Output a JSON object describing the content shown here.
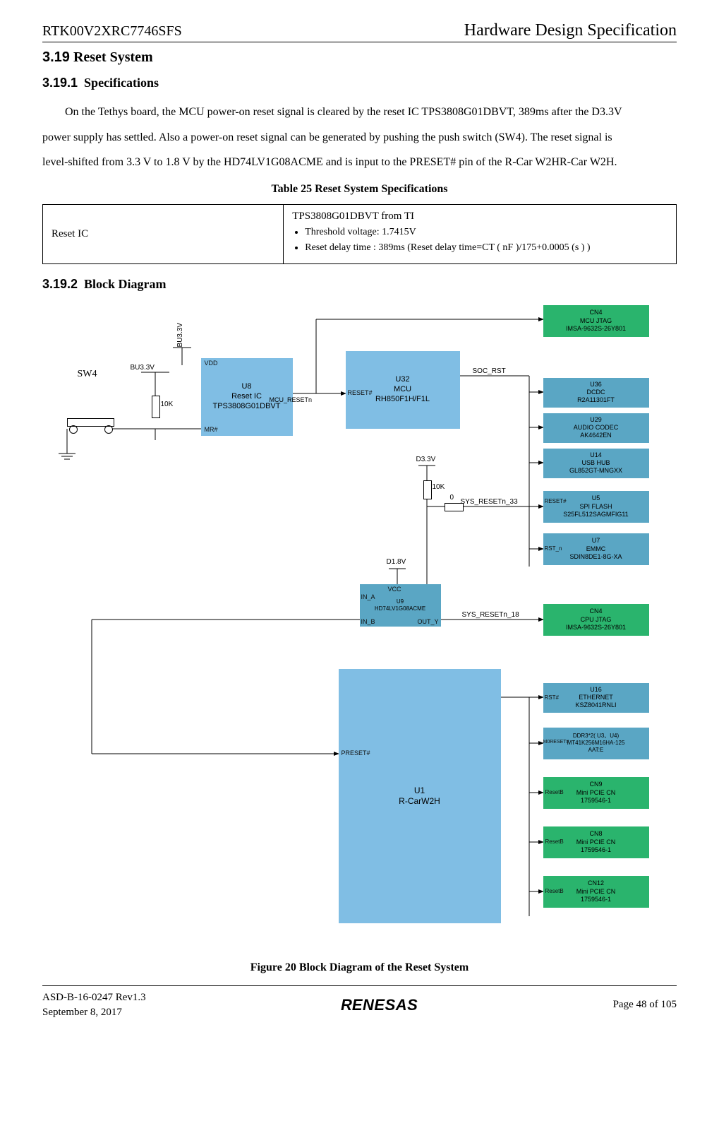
{
  "header": {
    "code": "RTK00V2XRC7746SFS",
    "title": "Hardware Design Specification"
  },
  "sections": {
    "h2_num": "3.19",
    "h2_title": "Reset System",
    "h3a_num": "3.19.1",
    "h3a_title": "Specifications",
    "h3b_num": "3.19.2",
    "h3b_title": "Block Diagram"
  },
  "body_p1_a": "On the Tethys board, the MCU power-on reset signal is cleared by the reset IC TPS3808G01DBVT, 389ms after the D3.3V",
  "body_p1_b": "power supply has settled. Also a power-on reset signal can be generated by pushing the push switch (SW4). The reset signal is",
  "body_p1_c": "level-shifted from 3.3 V to 1.8 V by the HD74LV1G08ACME and is input to the PRESET# pin of the R-Car W2HR-Car W2H.",
  "table_caption": "Table 25    Reset System Specifications",
  "spec_table": {
    "col1": "Reset IC",
    "row1": "TPS3808G01DBVT from TI",
    "bullets": [
      "Threshold voltage: 1.7415V",
      "Reset delay time : 389ms (Reset delay time=CT ( nF )/175+0.0005 (s ) )"
    ]
  },
  "figure_caption": "Figure 20    Block Diagram of the Reset System",
  "footer": {
    "line1": "ASD-B-16-0247    Rev1.3",
    "line2": "September 8, 2017",
    "logo": "RENESAS",
    "page": "Page  48  of 105"
  },
  "diagram": {
    "sw4": "SW4",
    "bu33v": "BU3.3V",
    "bu33v_v": "BU3.3V",
    "r10k": "10K",
    "u8_ref": "U8",
    "u8_name": "Reset IC",
    "u8_part": "TPS3808G01DBVT",
    "u8_vdd": "VDD",
    "u8_mr": "MR#",
    "net_mcu_resetn": "MCU_RESETn",
    "u32_ref": "U32",
    "u32_name": "MCU",
    "u32_part": "RH850F1H/F1L",
    "u32_reset": "RESET#",
    "net_soc_rst": "SOC_RST",
    "cn4_top_ref": "CN4",
    "cn4_top_name": "MCU JTAG",
    "cn4_top_part": "IMSA-9632S-26Y801",
    "u36_ref": "U36",
    "u36_name": "DCDC",
    "u36_part": "R2A11301FT",
    "u29_ref": "U29",
    "u29_name": "AUDIO CODEC",
    "u29_part": "AK4642EN",
    "u14_ref": "U14",
    "u14_name": "USB HUB",
    "u14_part": "GL852GT-MNGXX",
    "u5_ref": "U5",
    "u5_name": "SPI FLASH",
    "u5_part": "S25FL512SAGMFIG11",
    "u5_pin": "RESET#",
    "u7_ref": "U7",
    "u7_name": "EMMC",
    "u7_part": "SDIN8DE1-8G-XA",
    "u7_pin": "RST_n",
    "cn4_cpu_ref": "CN4",
    "cn4_cpu_name": "CPU JTAG",
    "cn4_cpu_part": "IMSA-9632S-26Y801",
    "u16_ref": "U16",
    "u16_name": "ETHERNET",
    "u16_part": "KSZ8041RNLI",
    "u16_pin": "RST#",
    "ddr_ref": "DDR3*2( U3、U4)",
    "ddr_part": "MT41K256M16HA-125",
    "ddr_part2": "AAT:E",
    "ddr_pin": "M0RESET#",
    "cn9_ref": "CN9",
    "cn9_name": "Mini PCIE CN",
    "cn9_part": "1759546-1",
    "cn9_pin": "ResetB",
    "cn8_ref": "CN8",
    "cn8_name": "Mini PCIE CN",
    "cn8_part": "1759546-1",
    "cn8_pin": "ResetB",
    "cn12_ref": "CN12",
    "cn12_name": "Mini PCIE CN",
    "cn12_part": "1759546-1",
    "cn12_pin": "ResetB",
    "u1_ref": "U1",
    "u1_name": "R-CarW2H",
    "u1_pin": "PRESET#",
    "d33v": "D3.3V",
    "r10k_b": "10K",
    "r0": "0",
    "net_sys_resetn_33": "SYS_RESETn_33",
    "u9_ref": "U9",
    "u9_part": "HD74LV1G08ACME",
    "u9_vcc": "VCC",
    "u9_ina": "IN_A",
    "u9_inb": "IN_B",
    "u9_outy": "OUT_Y",
    "d18v": "D1.8V",
    "net_sys_resetn_18": "SYS_RESETn_18"
  }
}
